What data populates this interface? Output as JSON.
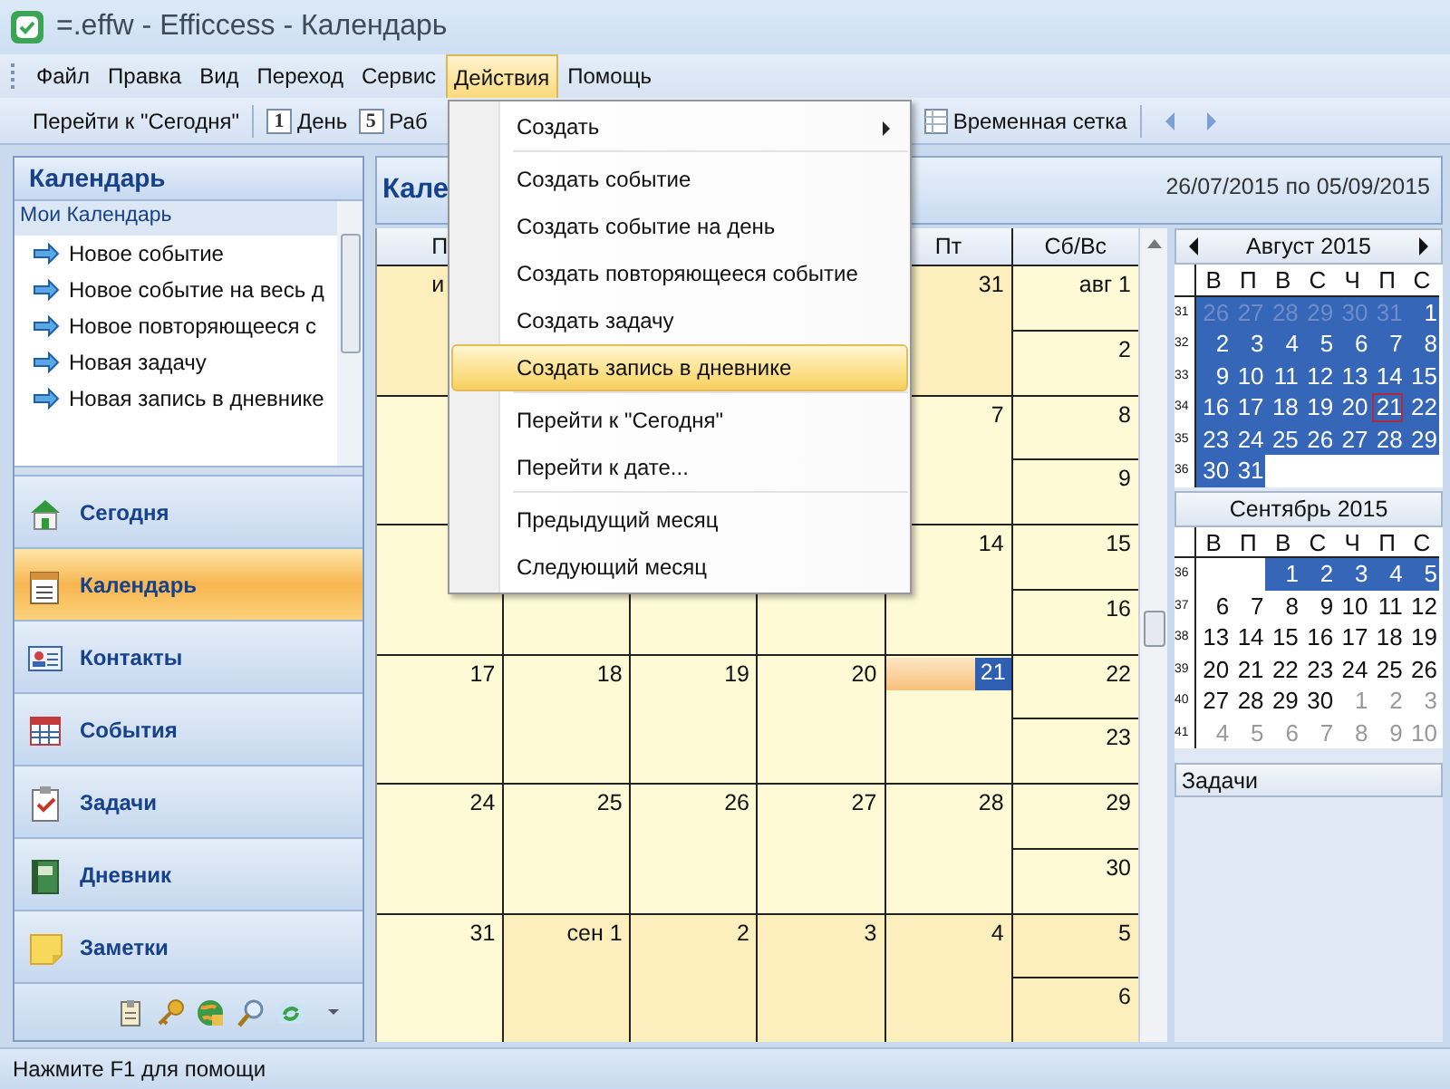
{
  "window": {
    "title": "=.effw - Efficcess - Календарь"
  },
  "menu_bar": [
    {
      "label": "Файл",
      "selected": false
    },
    {
      "label": "Правка",
      "selected": false
    },
    {
      "label": "Вид",
      "selected": false
    },
    {
      "label": "Переход",
      "selected": false
    },
    {
      "label": "Сервис",
      "selected": false
    },
    {
      "label": "Действия",
      "selected": true
    },
    {
      "label": "Помощь",
      "selected": false
    }
  ],
  "toolbar": [
    {
      "kind": "text",
      "label": "Перейти к \"Сегодня\""
    },
    {
      "kind": "day",
      "icon_text": "1",
      "label": "День"
    },
    {
      "kind": "day",
      "icon_text": "5",
      "label": "Раб"
    },
    {
      "kind": "grid",
      "label": "Временная сетка"
    },
    {
      "kind": "prev"
    },
    {
      "kind": "next"
    }
  ],
  "sidebar": {
    "title": "Календарь",
    "group": "Мои Календарь",
    "actions": [
      "Новое событие",
      "Новое событие на весь д",
      "Новое повторяющееся с",
      "Новая задачу",
      "Новая запись в дневнике"
    ],
    "nav": [
      {
        "label": "Сегодня",
        "selected": false
      },
      {
        "label": "Календарь",
        "selected": true
      },
      {
        "label": "Контакты",
        "selected": false
      },
      {
        "label": "События",
        "selected": false
      },
      {
        "label": "Задачи",
        "selected": false
      },
      {
        "label": "Дневник",
        "selected": false
      },
      {
        "label": "Заметки",
        "selected": false
      }
    ]
  },
  "calendar": {
    "title": "Кале",
    "range": "26/07/2015 по 05/09/2015",
    "columns": [
      {
        "label": "П"
      },
      {},
      {},
      {},
      {
        "label": "Пт"
      },
      {
        "label": "Сб/Вс"
      }
    ],
    "weeks": [
      {
        "cells": [
          {
            "kind": "day",
            "label": "и",
            "other_month": true,
            "today": false,
            "cut": true
          },
          {
            "kind": "hidden"
          },
          {
            "kind": "hidden"
          },
          {
            "kind": "hidden"
          },
          {
            "kind": "day",
            "label": "31",
            "other_month": true,
            "today": false,
            "cut": false
          },
          {
            "kind": "day",
            "label": "авг 1",
            "other_month": false,
            "today": false,
            "cut": false
          },
          {
            "kind": "day",
            "label": "2",
            "other_month": false,
            "today": false,
            "cut": false
          }
        ]
      },
      {
        "cells": [
          {
            "kind": "day",
            "other_month": false,
            "today": false
          },
          {
            "kind": "hidden"
          },
          {
            "kind": "hidden"
          },
          {
            "kind": "hidden"
          },
          {
            "kind": "day",
            "label": "7",
            "other_month": false,
            "today": false,
            "cut": false
          },
          {
            "kind": "day",
            "label": "8",
            "other_month": false,
            "today": false,
            "cut": false
          },
          {
            "kind": "day",
            "label": "9",
            "other_month": false,
            "today": false,
            "cut": false
          }
        ]
      },
      {
        "cells": [
          {
            "kind": "day",
            "other_month": false,
            "today": false
          },
          {
            "kind": "covered"
          },
          {
            "kind": "covered"
          },
          {
            "kind": "covered"
          },
          {
            "kind": "day",
            "label": "14",
            "other_month": false,
            "today": false,
            "cut": false
          },
          {
            "kind": "day",
            "label": "15",
            "other_month": false,
            "today": false,
            "cut": false
          },
          {
            "kind": "day",
            "label": "16",
            "other_month": false,
            "today": false,
            "cut": false
          }
        ]
      },
      {
        "cells": [
          {
            "kind": "day",
            "label": "17",
            "other_month": false,
            "today": false,
            "cut": false
          },
          {
            "kind": "day",
            "label": "18",
            "other_month": false,
            "today": false,
            "cut": false
          },
          {
            "kind": "day",
            "label": "19",
            "other_month": false,
            "today": false,
            "cut": false
          },
          {
            "kind": "day",
            "label": "20",
            "other_month": false,
            "today": false,
            "cut": false
          },
          {
            "kind": "day",
            "label": "21",
            "other_month": false,
            "today": true,
            "cut": false
          },
          {
            "kind": "day",
            "label": "22",
            "other_month": false,
            "today": false,
            "cut": false
          },
          {
            "kind": "day",
            "label": "23",
            "other_month": false,
            "today": false,
            "cut": false
          }
        ]
      },
      {
        "cells": [
          {
            "kind": "day",
            "label": "24",
            "other_month": false,
            "today": false,
            "cut": false
          },
          {
            "kind": "day",
            "label": "25",
            "other_month": false,
            "today": false,
            "cut": false
          },
          {
            "kind": "day",
            "label": "26",
            "other_month": false,
            "today": false,
            "cut": false
          },
          {
            "kind": "day",
            "label": "27",
            "other_month": false,
            "today": false,
            "cut": false
          },
          {
            "kind": "day",
            "label": "28",
            "other_month": false,
            "today": false,
            "cut": false
          },
          {
            "kind": "day",
            "label": "29",
            "other_month": false,
            "today": false,
            "cut": false
          },
          {
            "kind": "day",
            "label": "30",
            "other_month": false,
            "today": false,
            "cut": false
          }
        ]
      },
      {
        "cells": [
          {
            "kind": "day",
            "label": "31",
            "other_month": false,
            "today": false,
            "cut": false
          },
          {
            "kind": "day",
            "label": "сен 1",
            "other_month": true,
            "today": false,
            "cut": false
          },
          {
            "kind": "day",
            "label": "2",
            "other_month": true,
            "today": false,
            "cut": false
          },
          {
            "kind": "day",
            "label": "3",
            "other_month": true,
            "today": false,
            "cut": false
          },
          {
            "kind": "day",
            "label": "4",
            "other_month": true,
            "today": false,
            "cut": false
          },
          {
            "kind": "day",
            "label": "5",
            "other_month": true,
            "today": false,
            "cut": false
          },
          {
            "kind": "day",
            "label": "6",
            "other_month": true,
            "today": false,
            "cut": false
          }
        ]
      }
    ]
  },
  "mini_months": [
    {
      "title": "Август 2015",
      "nav": true,
      "weekdays": [
        "В",
        "П",
        "В",
        "С",
        "Ч",
        "П",
        "С"
      ],
      "weeks": [
        {
          "number": "31",
          "days": [
            {
              "kind": "day",
              "text": "26",
              "selected": true,
              "dim": true,
              "today": false
            },
            {
              "kind": "day",
              "text": "27",
              "selected": true,
              "dim": true,
              "today": false
            },
            {
              "kind": "day",
              "text": "28",
              "selected": true,
              "dim": true,
              "today": false
            },
            {
              "kind": "day",
              "text": "29",
              "selected": true,
              "dim": true,
              "today": false
            },
            {
              "kind": "day",
              "text": "30",
              "selected": true,
              "dim": true,
              "today": false
            },
            {
              "kind": "day",
              "text": "31",
              "selected": true,
              "dim": true,
              "today": false
            },
            {
              "kind": "day",
              "text": "1",
              "selected": true,
              "dim": false,
              "today": false
            }
          ]
        },
        {
          "number": "32",
          "days": [
            {
              "kind": "day",
              "text": "2",
              "selected": true,
              "dim": false,
              "today": false
            },
            {
              "kind": "day",
              "text": "3",
              "selected": true,
              "dim": false,
              "today": false
            },
            {
              "kind": "day",
              "text": "4",
              "selected": true,
              "dim": false,
              "today": false
            },
            {
              "kind": "day",
              "text": "5",
              "selected": true,
              "dim": false,
              "today": false
            },
            {
              "kind": "day",
              "text": "6",
              "selected": true,
              "dim": false,
              "today": false
            },
            {
              "kind": "day",
              "text": "7",
              "selected": true,
              "dim": false,
              "today": false
            },
            {
              "kind": "day",
              "text": "8",
              "selected": true,
              "dim": false,
              "today": false
            }
          ]
        },
        {
          "number": "33",
          "days": [
            {
              "kind": "day",
              "text": "9",
              "selected": true,
              "dim": false,
              "today": false
            },
            {
              "kind": "day",
              "text": "10",
              "selected": true,
              "dim": false,
              "today": false
            },
            {
              "kind": "day",
              "text": "11",
              "selected": true,
              "dim": false,
              "today": false
            },
            {
              "kind": "day",
              "text": "12",
              "selected": true,
              "dim": false,
              "today": false
            },
            {
              "kind": "day",
              "text": "13",
              "selected": true,
              "dim": false,
              "today": false
            },
            {
              "kind": "day",
              "text": "14",
              "selected": true,
              "dim": false,
              "today": false
            },
            {
              "kind": "day",
              "text": "15",
              "selected": true,
              "dim": false,
              "today": false
            }
          ]
        },
        {
          "number": "34",
          "days": [
            {
              "kind": "day",
              "text": "16",
              "selected": true,
              "dim": false,
              "today": false
            },
            {
              "kind": "day",
              "text": "17",
              "selected": true,
              "dim": false,
              "today": false
            },
            {
              "kind": "day",
              "text": "18",
              "selected": true,
              "dim": false,
              "today": false
            },
            {
              "kind": "day",
              "text": "19",
              "selected": true,
              "dim": false,
              "today": false
            },
            {
              "kind": "day",
              "text": "20",
              "selected": true,
              "dim": false,
              "today": false
            },
            {
              "kind": "day",
              "text": "21",
              "selected": true,
              "dim": false,
              "today": true
            },
            {
              "kind": "day",
              "text": "22",
              "selected": true,
              "dim": false,
              "today": false
            }
          ]
        },
        {
          "number": "35",
          "days": [
            {
              "kind": "day",
              "text": "23",
              "selected": true,
              "dim": false,
              "today": false
            },
            {
              "kind": "day",
              "text": "24",
              "selected": true,
              "dim": false,
              "today": false
            },
            {
              "kind": "day",
              "text": "25",
              "selected": true,
              "dim": false,
              "today": false
            },
            {
              "kind": "day",
              "text": "26",
              "selected": true,
              "dim": false,
              "today": false
            },
            {
              "kind": "day",
              "text": "27",
              "selected": true,
              "dim": false,
              "today": false
            },
            {
              "kind": "day",
              "text": "28",
              "selected": true,
              "dim": false,
              "today": false
            },
            {
              "kind": "day",
              "text": "29",
              "selected": true,
              "dim": false,
              "today": false
            }
          ]
        },
        {
          "number": "36",
          "days": [
            {
              "kind": "day",
              "text": "30",
              "selected": true,
              "dim": false,
              "today": false
            },
            {
              "kind": "day",
              "text": "31",
              "selected": true,
              "dim": false,
              "today": false
            },
            {
              "kind": "empty"
            },
            {
              "kind": "empty"
            },
            {
              "kind": "empty"
            },
            {
              "kind": "empty"
            },
            {
              "kind": "empty"
            }
          ]
        }
      ]
    },
    {
      "title": "Сентябрь 2015",
      "nav": false,
      "weekdays": [
        "В",
        "П",
        "В",
        "С",
        "Ч",
        "П",
        "С"
      ],
      "weeks": [
        {
          "number": "36",
          "days": [
            {
              "kind": "empty"
            },
            {
              "kind": "empty"
            },
            {
              "kind": "day",
              "text": "1",
              "selected": true,
              "dim": false,
              "today": false
            },
            {
              "kind": "day",
              "text": "2",
              "selected": true,
              "dim": false,
              "today": false
            },
            {
              "kind": "day",
              "text": "3",
              "selected": true,
              "dim": false,
              "today": false
            },
            {
              "kind": "day",
              "text": "4",
              "selected": true,
              "dim": false,
              "today": false
            },
            {
              "kind": "day",
              "text": "5",
              "selected": true,
              "dim": false,
              "today": false
            }
          ]
        },
        {
          "number": "37",
          "days": [
            {
              "kind": "day",
              "text": "6",
              "selected": false,
              "dim": false,
              "today": false
            },
            {
              "kind": "day",
              "text": "7",
              "selected": false,
              "dim": false,
              "today": false
            },
            {
              "kind": "day",
              "text": "8",
              "selected": false,
              "dim": false,
              "today": false
            },
            {
              "kind": "day",
              "text": "9",
              "selected": false,
              "dim": false,
              "today": false
            },
            {
              "kind": "day",
              "text": "10",
              "selected": false,
              "dim": false,
              "today": false
            },
            {
              "kind": "day",
              "text": "11",
              "selected": false,
              "dim": false,
              "today": false
            },
            {
              "kind": "day",
              "text": "12",
              "selected": false,
              "dim": false,
              "today": false
            }
          ]
        },
        {
          "number": "38",
          "days": [
            {
              "kind": "day",
              "text": "13",
              "selected": false,
              "dim": false,
              "today": false
            },
            {
              "kind": "day",
              "text": "14",
              "selected": false,
              "dim": false,
              "today": false
            },
            {
              "kind": "day",
              "text": "15",
              "selected": false,
              "dim": false,
              "today": false
            },
            {
              "kind": "day",
              "text": "16",
              "selected": false,
              "dim": false,
              "today": false
            },
            {
              "kind": "day",
              "text": "17",
              "selected": false,
              "dim": false,
              "today": false
            },
            {
              "kind": "day",
              "text": "18",
              "selected": false,
              "dim": false,
              "today": false
            },
            {
              "kind": "day",
              "text": "19",
              "selected": false,
              "dim": false,
              "today": false
            }
          ]
        },
        {
          "number": "39",
          "days": [
            {
              "kind": "day",
              "text": "20",
              "selected": false,
              "dim": false,
              "today": false
            },
            {
              "kind": "day",
              "text": "21",
              "selected": false,
              "dim": false,
              "today": false
            },
            {
              "kind": "day",
              "text": "22",
              "selected": false,
              "dim": false,
              "today": false
            },
            {
              "kind": "day",
              "text": "23",
              "selected": false,
              "dim": false,
              "today": false
            },
            {
              "kind": "day",
              "text": "24",
              "selected": false,
              "dim": false,
              "today": false
            },
            {
              "kind": "day",
              "text": "25",
              "selected": false,
              "dim": false,
              "today": false
            },
            {
              "kind": "day",
              "text": "26",
              "selected": false,
              "dim": false,
              "today": false
            }
          ]
        },
        {
          "number": "40",
          "days": [
            {
              "kind": "day",
              "text": "27",
              "selected": false,
              "dim": false,
              "today": false
            },
            {
              "kind": "day",
              "text": "28",
              "selected": false,
              "dim": false,
              "today": false
            },
            {
              "kind": "day",
              "text": "29",
              "selected": false,
              "dim": false,
              "today": false
            },
            {
              "kind": "day",
              "text": "30",
              "selected": false,
              "dim": false,
              "today": false
            },
            {
              "kind": "day",
              "text": "1",
              "selected": false,
              "dim": true,
              "today": false
            },
            {
              "kind": "day",
              "text": "2",
              "selected": false,
              "dim": true,
              "today": false
            },
            {
              "kind": "day",
              "text": "3",
              "selected": false,
              "dim": true,
              "today": false
            }
          ]
        },
        {
          "number": "41",
          "days": [
            {
              "kind": "day",
              "text": "4",
              "selected": false,
              "dim": true,
              "today": false
            },
            {
              "kind": "day",
              "text": "5",
              "selected": false,
              "dim": true,
              "today": false
            },
            {
              "kind": "day",
              "text": "6",
              "selected": false,
              "dim": true,
              "today": false
            },
            {
              "kind": "day",
              "text": "7",
              "selected": false,
              "dim": true,
              "today": false
            },
            {
              "kind": "day",
              "text": "8",
              "selected": false,
              "dim": true,
              "today": false
            },
            {
              "kind": "day",
              "text": "9",
              "selected": false,
              "dim": true,
              "today": false
            },
            {
              "kind": "day",
              "text": "10",
              "selected": false,
              "dim": true,
              "today": false
            }
          ]
        }
      ]
    }
  ],
  "tasks_panel": {
    "title": "Задачи"
  },
  "context_menu": [
    {
      "kind": "item",
      "label": "Создать",
      "submenu": true,
      "selected": false
    },
    {
      "kind": "separator"
    },
    {
      "kind": "item",
      "label": "Создать событие",
      "submenu": false,
      "selected": false
    },
    {
      "kind": "item",
      "label": "Создать событие на день",
      "submenu": false,
      "selected": false
    },
    {
      "kind": "item",
      "label": "Создать повторяющееся событие",
      "submenu": false,
      "selected": false
    },
    {
      "kind": "item",
      "label": "Создать задачу",
      "submenu": false,
      "selected": false
    },
    {
      "kind": "item",
      "label": "Создать запись в дневнике",
      "submenu": false,
      "selected": true
    },
    {
      "kind": "separator"
    },
    {
      "kind": "item",
      "label": "Перейти к \"Сегодня\"",
      "submenu": false,
      "selected": false
    },
    {
      "kind": "item",
      "label": "Перейти к дате...",
      "submenu": false,
      "selected": false
    },
    {
      "kind": "separator"
    },
    {
      "kind": "item",
      "label": "Предыдущий месяц",
      "submenu": false,
      "selected": false
    },
    {
      "kind": "item",
      "label": "Следующий месяц",
      "submenu": false,
      "selected": false
    }
  ],
  "status_bar": "Нажмите F1 для помощи"
}
